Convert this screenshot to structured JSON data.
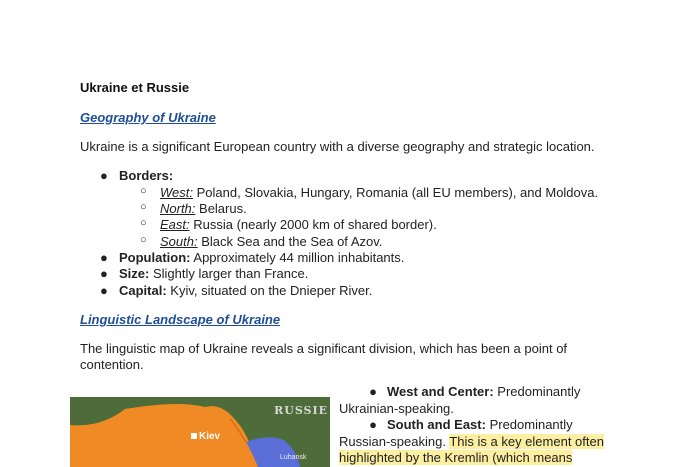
{
  "title": "Ukraine et Russie",
  "geography": {
    "heading": "Geography of Ukraine",
    "intro": "Ukraine is a significant European country with a diverse geography and strategic location.",
    "bullet_symbol": "●",
    "sub_symbol": "○",
    "borders": {
      "label": "Borders:",
      "items": [
        {
          "dir": "West:",
          "text": " Poland, Slovakia, Hungary, Romania (all EU members), and Moldova."
        },
        {
          "dir": "North:",
          "text": " Belarus."
        },
        {
          "dir": "East:",
          "text": " Russia (nearly 2000 km of shared border)."
        },
        {
          "dir": "South:",
          "text": " Black Sea and the Sea of Azov."
        }
      ]
    },
    "facts": [
      {
        "label": "Population:",
        "text": " Approximately 44 million inhabitants."
      },
      {
        "label": "Size:",
        "text": " Slightly larger than France."
      },
      {
        "label": "Capital:",
        "text": " Kyiv, situated on the Dnieper River."
      }
    ]
  },
  "linguistic": {
    "heading": "Linguistic Landscape of Ukraine",
    "intro_line1": "The linguistic map of Ukraine reveals a significant division, which has been a point of",
    "intro_line2": "contention.",
    "west_label": "West and Center:",
    "west_text_a": " Predominantly",
    "west_text_b": "Ukrainian-speaking.",
    "east_label": "South and East:",
    "east_text_a": " Predominantly",
    "east_text_b": "Russian-speaking. ",
    "highlight_a": "This is a key element often",
    "highlight_b": "highlighted by the Kremlin (which means"
  },
  "map": {
    "country_label": "RUSSIE",
    "city_label": "Kiev",
    "region_label": "Luhansk",
    "colors": {
      "ukrainian": "#f08a24",
      "russian": "#5a6ed8",
      "land": "#4e6c3a"
    }
  }
}
